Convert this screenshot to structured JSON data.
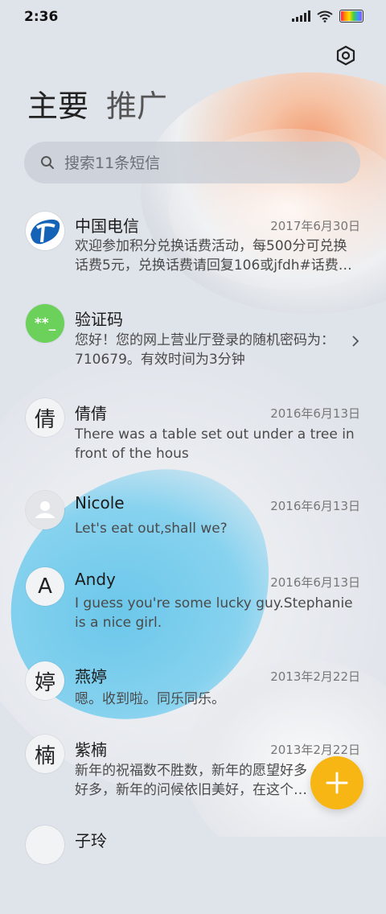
{
  "status_bar": {
    "time": "2:36"
  },
  "tabs": [
    {
      "label": "主要"
    },
    {
      "label": "推广"
    }
  ],
  "search": {
    "placeholder": "搜索11条短信"
  },
  "conversations": [
    {
      "name": "中国电信",
      "date": "2017年6月30日",
      "preview": "欢迎参加积分兑换话费活动，每500分可兑换话费5元，兑换话费请回复106或jfdh#话费…",
      "avatar": "china-telecom-logo"
    },
    {
      "name": "验证码",
      "date": "",
      "preview": "您好！您的网上营业厅登录的随机密码为：710679。有效时间为3分钟",
      "avatar_text": "**_"
    },
    {
      "name": "倩倩",
      "date": "2016年6月13日",
      "preview": "There was a table set out under a tree in front of the hous",
      "avatar_text": "倩"
    },
    {
      "name": "Nicole",
      "date": "2016年6月13日",
      "preview": "Let's eat out,shall we?",
      "avatar": "person-icon"
    },
    {
      "name": "Andy",
      "date": "2016年6月13日",
      "preview": "I guess you're some lucky guy.Stephanie is a nice girl.",
      "avatar_text": "A"
    },
    {
      "name": "燕婷",
      "date": "2013年2月22日",
      "preview": "嗯。收到啦。同乐同乐。",
      "avatar_text": "婷"
    },
    {
      "name": "紫楠",
      "date": "2013年2月22日",
      "preview": "新年的祝福数不胜数，新年的愿望好多好多，新年的问候依旧美好，在这个温馨的时刻…",
      "avatar_text": "楠"
    },
    {
      "name": "子玲",
      "date": "",
      "preview": "",
      "avatar_text": ""
    }
  ],
  "colors": {
    "fab": "#f7b614",
    "verify_avatar": "#6bd15a",
    "telecom_blue": "#1463b6"
  },
  "icons": {
    "settings": "settings-hexagon-icon",
    "fab": "plus-icon",
    "search": "search-icon"
  }
}
